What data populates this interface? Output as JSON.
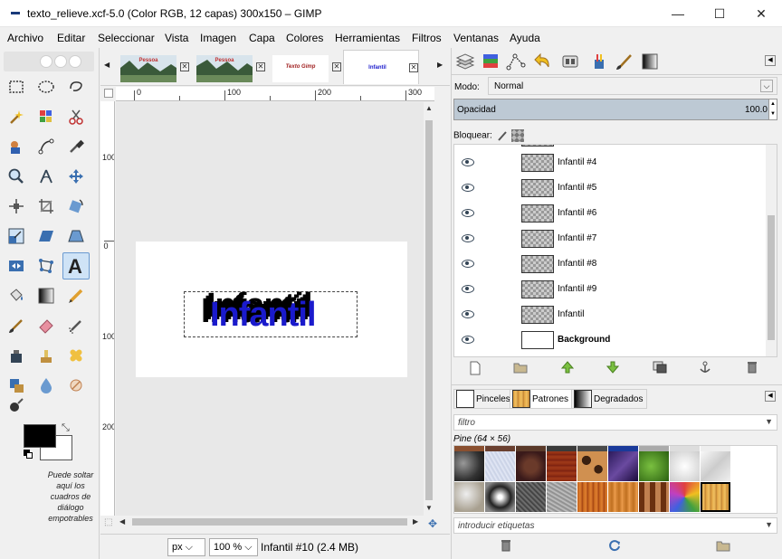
{
  "window": {
    "title": "texto_relieve.xcf-5.0 (Color RGB, 12 capas) 300x150 – GIMP",
    "minimize": "—",
    "maximize": "☐",
    "close": "✕"
  },
  "menu": [
    "Archivo",
    "Editar",
    "Seleccionar",
    "Vista",
    "Imagen",
    "Capa",
    "Colores",
    "Herramientas",
    "Filtros",
    "Ventanas",
    "Ayuda"
  ],
  "toolbox": {
    "drop_hint": "Puede soltar aquí los cuadros de diálogo empotrables",
    "fg_color": "#000000",
    "bg_color": "#ffffff"
  },
  "image_tabs": [
    {
      "label": "Pessoa",
      "thumb": "landscape"
    },
    {
      "label": "Pessoa",
      "thumb": "landscape"
    },
    {
      "label": "Texto Gimp",
      "thumb": "text"
    },
    {
      "label": "Infantil",
      "thumb": "text-blue"
    }
  ],
  "canvas": {
    "ruler_h": [
      "0",
      "100",
      "200",
      "300"
    ],
    "ruler_v": [
      "100",
      "0",
      "100",
      "200"
    ],
    "text": "Infantil",
    "text_color": "#1a1acc"
  },
  "statusbar": {
    "unit": "px",
    "zoom": "100 %",
    "info": "Infantil #10 (2.4 MB)"
  },
  "layers": {
    "mode_label": "Modo:",
    "mode_value": "Normal",
    "opacity_label": "Opacidad",
    "opacity_value": "100.0",
    "lock_label": "Bloquear:",
    "items": [
      {
        "name": "Infantil #4",
        "bold": false
      },
      {
        "name": "Infantil #5",
        "bold": false
      },
      {
        "name": "Infantil #6",
        "bold": false
      },
      {
        "name": "Infantil #7",
        "bold": false
      },
      {
        "name": "Infantil #8",
        "bold": false
      },
      {
        "name": "Infantil #9",
        "bold": false
      },
      {
        "name": "Infantil",
        "bold": false
      },
      {
        "name": "Background",
        "bold": true
      }
    ]
  },
  "resources": {
    "tabs": [
      "Pinceles",
      "Patrones",
      "Degradados"
    ],
    "filter_placeholder": "filtro",
    "pattern_title": "Pine (64 × 56)",
    "tags_placeholder": "introducir etiquetas"
  }
}
